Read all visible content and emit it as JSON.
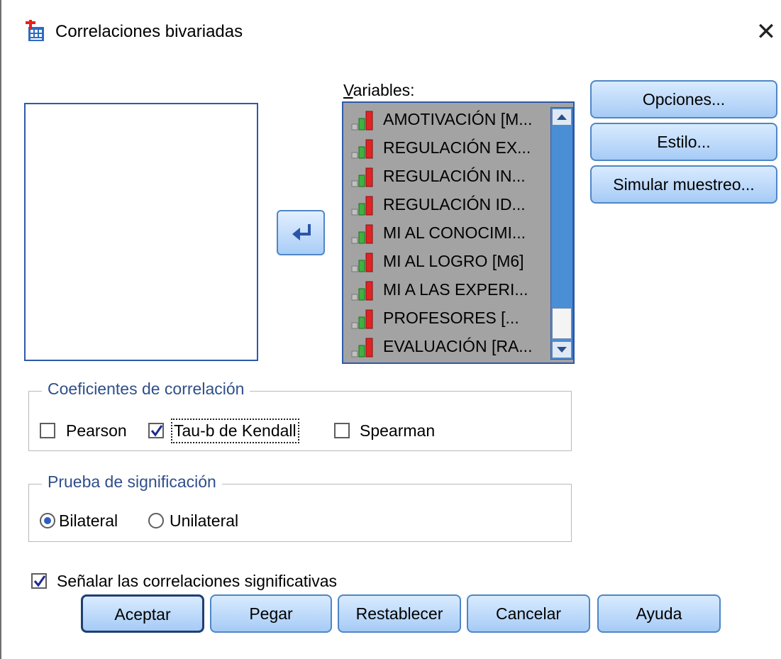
{
  "window": {
    "title": "Correlaciones bivariadas",
    "icon": "bivariate-correlations-icon",
    "close_icon": "close-icon"
  },
  "source_list": {
    "items": []
  },
  "move_button": {
    "icon": "arrow-left-icon"
  },
  "variables": {
    "label": "Variables:",
    "items": [
      {
        "label": "AMOTIVACIÓN  [M..."
      },
      {
        "label": "REGULACIÓN EX..."
      },
      {
        "label": "REGULACIÓN IN..."
      },
      {
        "label": "REGULACIÓN ID..."
      },
      {
        "label": "MI AL CONOCIMI..."
      },
      {
        "label": "MI AL LOGRO [M6]"
      },
      {
        "label": "MI A LAS EXPERI..."
      },
      {
        "label": "PROFESORES [..."
      },
      {
        "label": "EVALUACIÓN [RA..."
      }
    ],
    "item_icon": "scale-variable-icon"
  },
  "side_buttons": {
    "options": "Opciones...",
    "style": "Estilo...",
    "bootstrap": "Simular muestreo..."
  },
  "coefficients": {
    "title": "Coeficientes de correlación",
    "pearson": {
      "label": "Pearson",
      "checked": false
    },
    "kendall": {
      "label": "Tau-b de Kendall",
      "checked": true
    },
    "spearman": {
      "label": "Spearman",
      "checked": false
    }
  },
  "significance": {
    "title": "Prueba de significación",
    "two_tailed": {
      "label": "Bilateral",
      "selected": true
    },
    "one_tailed": {
      "label": "Unilateral",
      "selected": false
    }
  },
  "flag_significant": {
    "label": "Señalar las correlaciones significativas",
    "checked": true
  },
  "buttons": {
    "ok": "Aceptar",
    "paste": "Pegar",
    "reset": "Restablecer",
    "cancel": "Cancelar",
    "help": "Ayuda"
  },
  "colors": {
    "button_border": "#4f86c6",
    "group_title": "#2f4f8a",
    "list_selected_bg": "#a3a3a3",
    "scrollbar": "#4a8fd6"
  }
}
